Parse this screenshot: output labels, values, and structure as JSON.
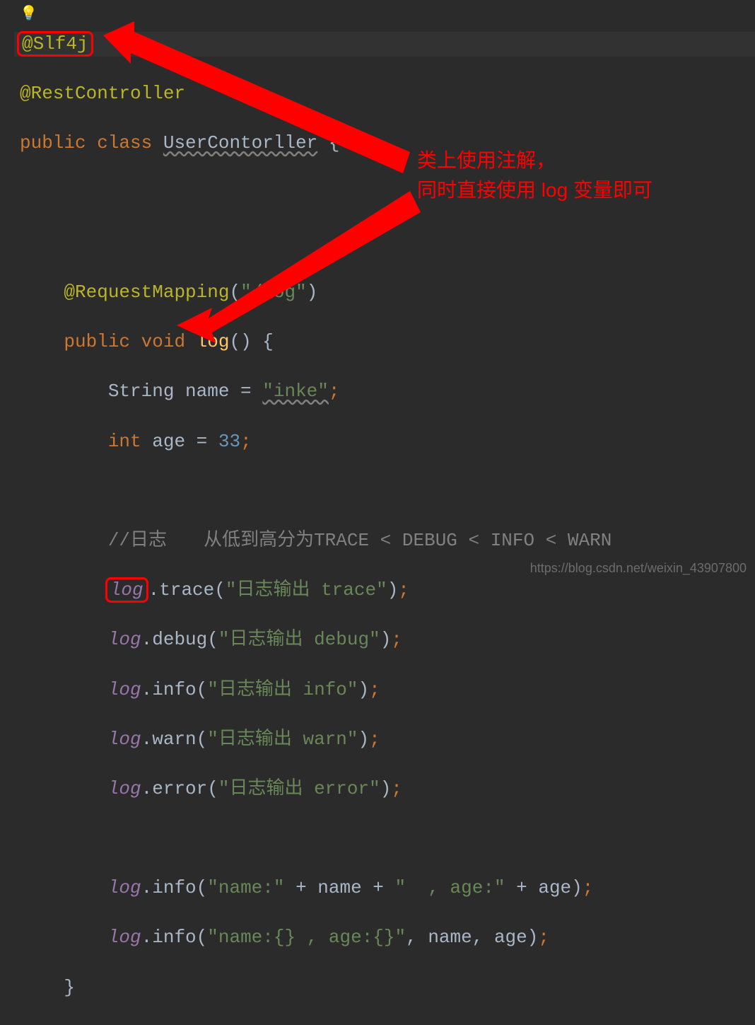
{
  "callout": {
    "line1": "类上使用注解，",
    "line2": "同时直接使用 log 变量即可"
  },
  "code": {
    "l1_annotation": "@Slf4j",
    "l2_annotation": "@RestController",
    "l3_kw1": "public ",
    "l3_kw2": "class ",
    "l3_name": "UserContorller",
    "l3_brace": " {",
    "l4_anno": "@RequestMapping",
    "l4_paren_open": "(",
    "l4_str": "\"/log\"",
    "l4_paren_close": ")",
    "l5_kw1": "public ",
    "l5_kw2": "void ",
    "l5_method": "log",
    "l5_rest": "() {",
    "l6_type": "String ",
    "l6_var": "name = ",
    "l6_str": "\"inke\"",
    "l6_semi": ";",
    "l7_kw": "int ",
    "l7_var": "age = ",
    "l7_num": "33",
    "l7_semi": ";",
    "l8_comment_pre": "//日志",
    "l8_comment_post": "从低到高分为TRACE < DEBUG < INFO < WARN",
    "l9_log": "log",
    "l9_method": ".trace(",
    "l9_str": "\"日志输出 trace\"",
    "l9_end": ")",
    "l9_semi": ";",
    "l10_log": "log",
    "l10_method": ".debug(",
    "l10_str": "\"日志输出 debug\"",
    "l10_end": ")",
    "l10_semi": ";",
    "l11_log": "log",
    "l11_method": ".info(",
    "l11_str": "\"日志输出 info\"",
    "l11_end": ")",
    "l11_semi": ";",
    "l12_log": "log",
    "l12_method": ".warn(",
    "l12_str": "\"日志输出 warn\"",
    "l12_end": ")",
    "l12_semi": ";",
    "l13_log": "log",
    "l13_method": ".error(",
    "l13_str": "\"日志输出 error\"",
    "l13_end": ")",
    "l13_semi": ";",
    "l14_log": "log",
    "l14_method": ".info(",
    "l14_str1": "\"name:\"",
    "l14_plus1": " + name + ",
    "l14_str2": "\"  , age:\"",
    "l14_plus2": " + age)",
    "l14_semi": ";",
    "l15_log": "log",
    "l15_method": ".info(",
    "l15_str": "\"name:{} , age:{}\"",
    "l15_args": ", name, age)",
    "l15_semi": ";",
    "l16_brace": "}"
  },
  "watermark": "https://blog.csdn.net/weixin_43907800",
  "colors": {
    "arrow": "#ff0000"
  }
}
